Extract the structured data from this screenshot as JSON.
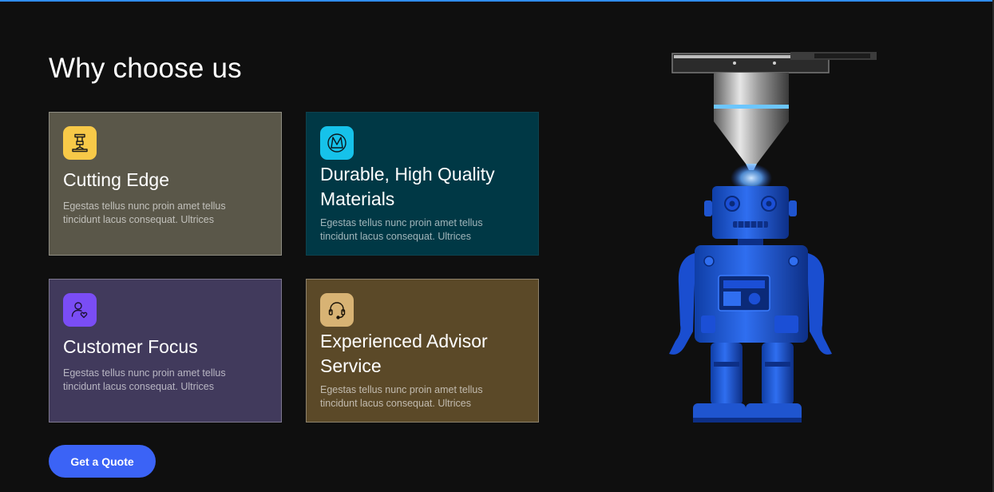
{
  "section": {
    "title": "Why choose us"
  },
  "colors": {
    "accent_line": "#2f8cf0",
    "background": "#0f0f0f",
    "cta": "#3b63f6"
  },
  "cards": [
    {
      "title": "Cutting Edge",
      "text": "Egestas tellus nunc proin amet tellus tincidunt lacus consequat. Ultrices",
      "icon": "laser-machine-icon",
      "background": "#5a5749",
      "icon_color": "#f7c948"
    },
    {
      "title": "Durable, High Quality Materials",
      "text": "Egestas tellus nunc proin amet tellus tincidunt lacus consequat. Ultrices",
      "icon": "material-emblem-icon",
      "background": "#003845",
      "icon_color": "#16c2ea"
    },
    {
      "title": "Customer Focus",
      "text": "Egestas tellus nunc proin amet tellus tincidunt lacus consequat. Ultrices",
      "icon": "user-heart-icon",
      "background": "#413a5c",
      "icon_color": "#7a4df5"
    },
    {
      "title": "Experienced Advisor Service",
      "text": "Egestas tellus nunc proin amet tellus tincidunt lacus consequat. Ultrices",
      "icon": "headset-icon",
      "background": "#5b4928",
      "icon_color": "#d8b374"
    }
  ],
  "cta": {
    "label": "Get a Quote"
  },
  "hero": {
    "image": "robot-3d-print-illustration"
  }
}
